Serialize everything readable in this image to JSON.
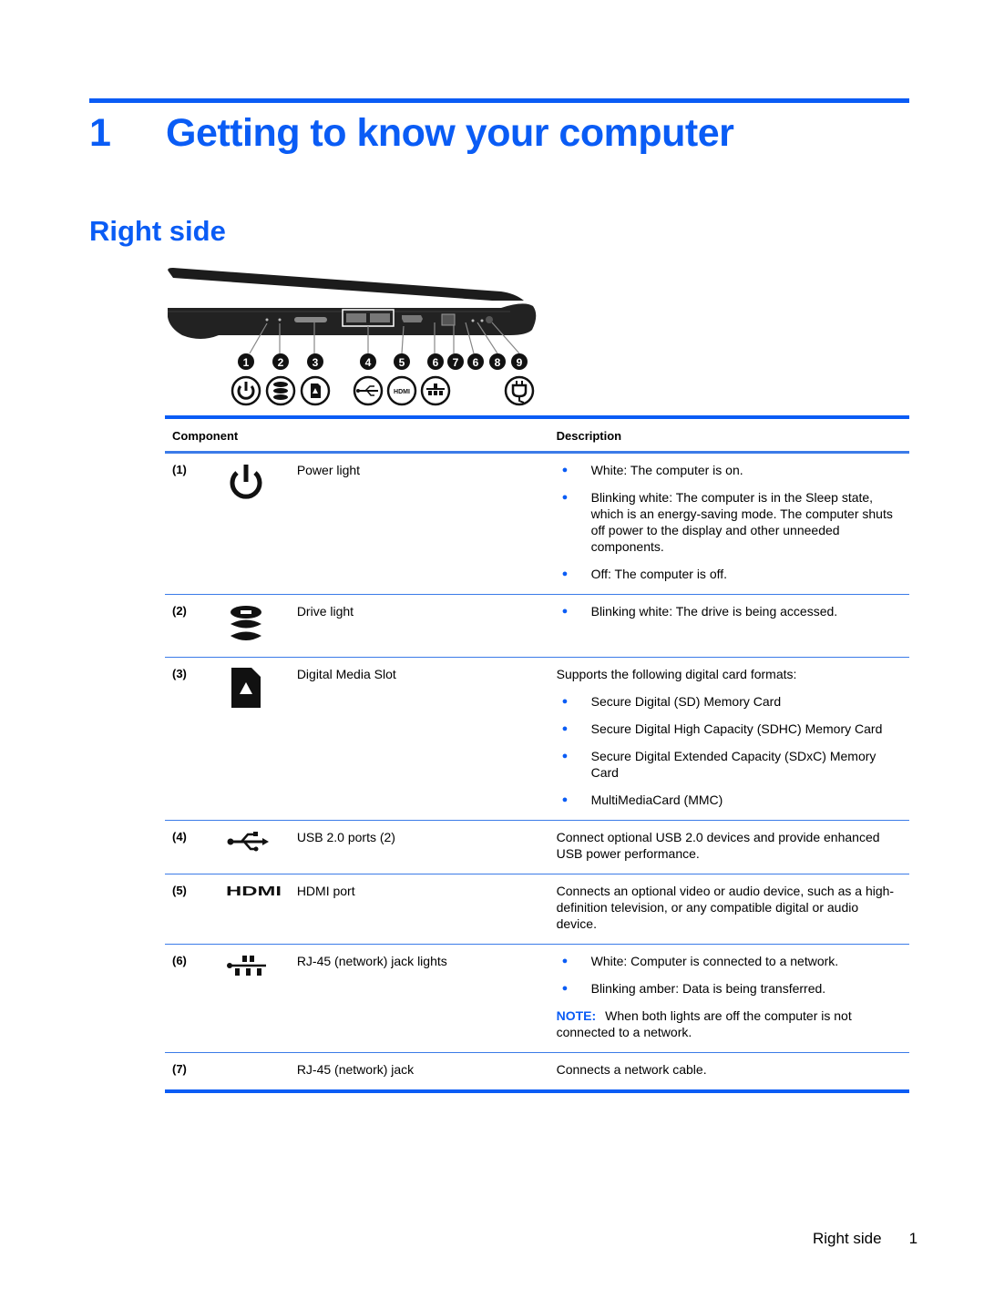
{
  "chapter": {
    "number": "1",
    "title": "Getting to know your computer"
  },
  "section": {
    "title": "Right side"
  },
  "illustration": {
    "callouts": [
      "1",
      "2",
      "3",
      "4",
      "5",
      "6",
      "7",
      "6",
      "8",
      "9"
    ],
    "icons": [
      "power-icon",
      "drive-icon",
      "sd-card-icon",
      "usb-icon",
      "hdmi-icon",
      "network-icon",
      "power-plug-icon"
    ],
    "hdmi_text": "HDMI"
  },
  "table": {
    "headers": {
      "component": "Component",
      "description": "Description"
    },
    "rows": [
      {
        "num": "(1)",
        "icon": "power-icon",
        "name": "Power light",
        "intro": "",
        "bullets": [
          "White: The computer is on.",
          "Blinking white: The computer is in the Sleep state, which is an energy-saving mode. The computer shuts off power to the display and other unneeded components.",
          "Off: The computer is off."
        ]
      },
      {
        "num": "(2)",
        "icon": "drive-icon",
        "name": "Drive light",
        "intro": "",
        "bullets": [
          "Blinking white: The drive is being accessed."
        ]
      },
      {
        "num": "(3)",
        "icon": "sd-card-icon",
        "name": "Digital Media Slot",
        "intro": "Supports the following digital card formats:",
        "bullets": [
          "Secure Digital (SD) Memory Card",
          "Secure Digital High Capacity (SDHC) Memory Card",
          "Secure Digital Extended Capacity (SDxC) Memory Card",
          "MultiMediaCard (MMC)"
        ]
      },
      {
        "num": "(4)",
        "icon": "usb-icon",
        "name": "USB 2.0 ports (2)",
        "intro": "Connect optional USB 2.0 devices and provide enhanced USB power performance.",
        "bullets": []
      },
      {
        "num": "(5)",
        "icon": "hdmi-icon",
        "name": "HDMI port",
        "intro": "Connects an optional video or audio device, such as a high-definition television, or any compatible digital or audio device.",
        "bullets": []
      },
      {
        "num": "(6)",
        "icon": "network-icon",
        "name": "RJ-45 (network) jack lights",
        "intro": "",
        "bullets": [
          "White: Computer is connected to a network.",
          "Blinking amber: Data is being transferred."
        ],
        "note_label": "NOTE:",
        "note_text": "When both lights are off the computer is not connected to a network."
      },
      {
        "num": "(7)",
        "icon": "",
        "name": "RJ-45 (network) jack",
        "intro": "Connects a network cable.",
        "bullets": []
      }
    ]
  },
  "footer": {
    "section": "Right side",
    "page": "1"
  },
  "colors": {
    "accent": "#0a5cf5"
  }
}
